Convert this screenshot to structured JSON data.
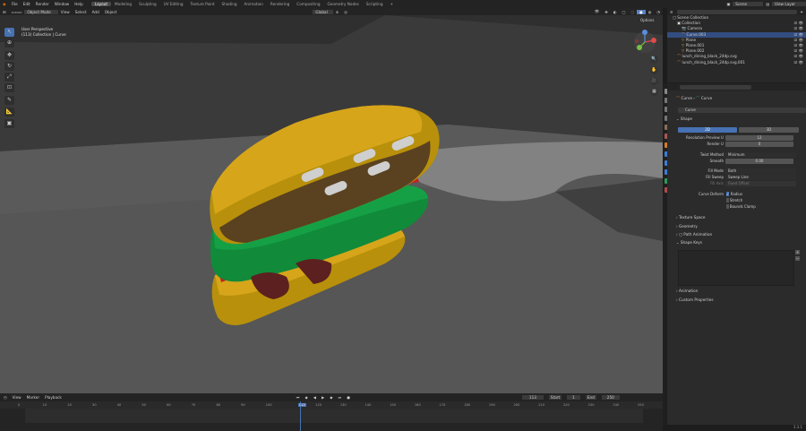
{
  "menu": [
    "File",
    "Edit",
    "Render",
    "Window",
    "Help"
  ],
  "workspaces": [
    "Layout",
    "Modeling",
    "Sculpting",
    "UV Editing",
    "Texture Paint",
    "Shading",
    "Animation",
    "Rendering",
    "Compositing",
    "Geometry Nodes",
    "Scripting"
  ],
  "active_workspace": "Layout",
  "scene_name": "Scene",
  "view_layer": "View Layer",
  "viewport": {
    "mode": "Object Mode",
    "menus": [
      "View",
      "Select",
      "Add",
      "Object"
    ],
    "transform": "Global",
    "overlay_title": "User Perspective",
    "overlay_sub": "(113) Collection | Curve",
    "options": "Options"
  },
  "outliner": {
    "root": "Scene Collection",
    "items": [
      {
        "label": "Collection",
        "indent": 1
      },
      {
        "label": "Camera",
        "indent": 2
      },
      {
        "label": "Curve.003",
        "indent": 2
      },
      {
        "label": "Plane",
        "indent": 2
      },
      {
        "label": "Plane.001",
        "indent": 2
      },
      {
        "label": "Plane.002",
        "indent": 2
      },
      {
        "label": "lunch_dining_black_24dp.svg",
        "indent": 1
      },
      {
        "label": "lunch_dining_black_24dp.svg.001",
        "indent": 1
      }
    ]
  },
  "properties": {
    "crumb_object": "Curve",
    "crumb_data": "Curve",
    "data_name": "Curve",
    "section_shape": "Shape",
    "toggle_2d": "2D",
    "toggle_3d": "3D",
    "res_preview_label": "Resolution Preview U",
    "res_preview_value": "12",
    "render_u_label": "Render U",
    "render_u_value": "0",
    "twist_method_label": "Twist Method",
    "twist_method_value": "Minimum",
    "smooth_label": "Smooth",
    "smooth_value": "0.00",
    "fill_mode_label": "Fill Mode",
    "fill_mode_value": "Both",
    "fill_sweep_label": "Fill Sweep",
    "fill_sweep_value": "Sweep Line",
    "fill_sub_label": "Fill Axis",
    "fill_sub_value": "Fixed Offset",
    "curve_deform_label": "Curve Deform",
    "cb_radius": "Radius",
    "cb_stretch": "Stretch",
    "cb_bounds": "Bounds Clamp",
    "sections": [
      "Texture Space",
      "Geometry",
      "Path Animation",
      "Shape Keys"
    ],
    "sections2": [
      "Animation",
      "Custom Properties"
    ]
  },
  "timeline": {
    "menus": [
      "View",
      "Marker",
      "Playback"
    ],
    "current_frame": "113",
    "start_label": "Start",
    "start_value": "1",
    "end_label": "End",
    "end_value": "250",
    "ticks": [
      "0",
      "10",
      "20",
      "30",
      "40",
      "50",
      "60",
      "70",
      "80",
      "90",
      "100",
      "113",
      "120",
      "130",
      "140",
      "150",
      "160",
      "170",
      "180",
      "190",
      "200",
      "210",
      "220",
      "230",
      "240",
      "250"
    ]
  },
  "status": "3.3.1"
}
